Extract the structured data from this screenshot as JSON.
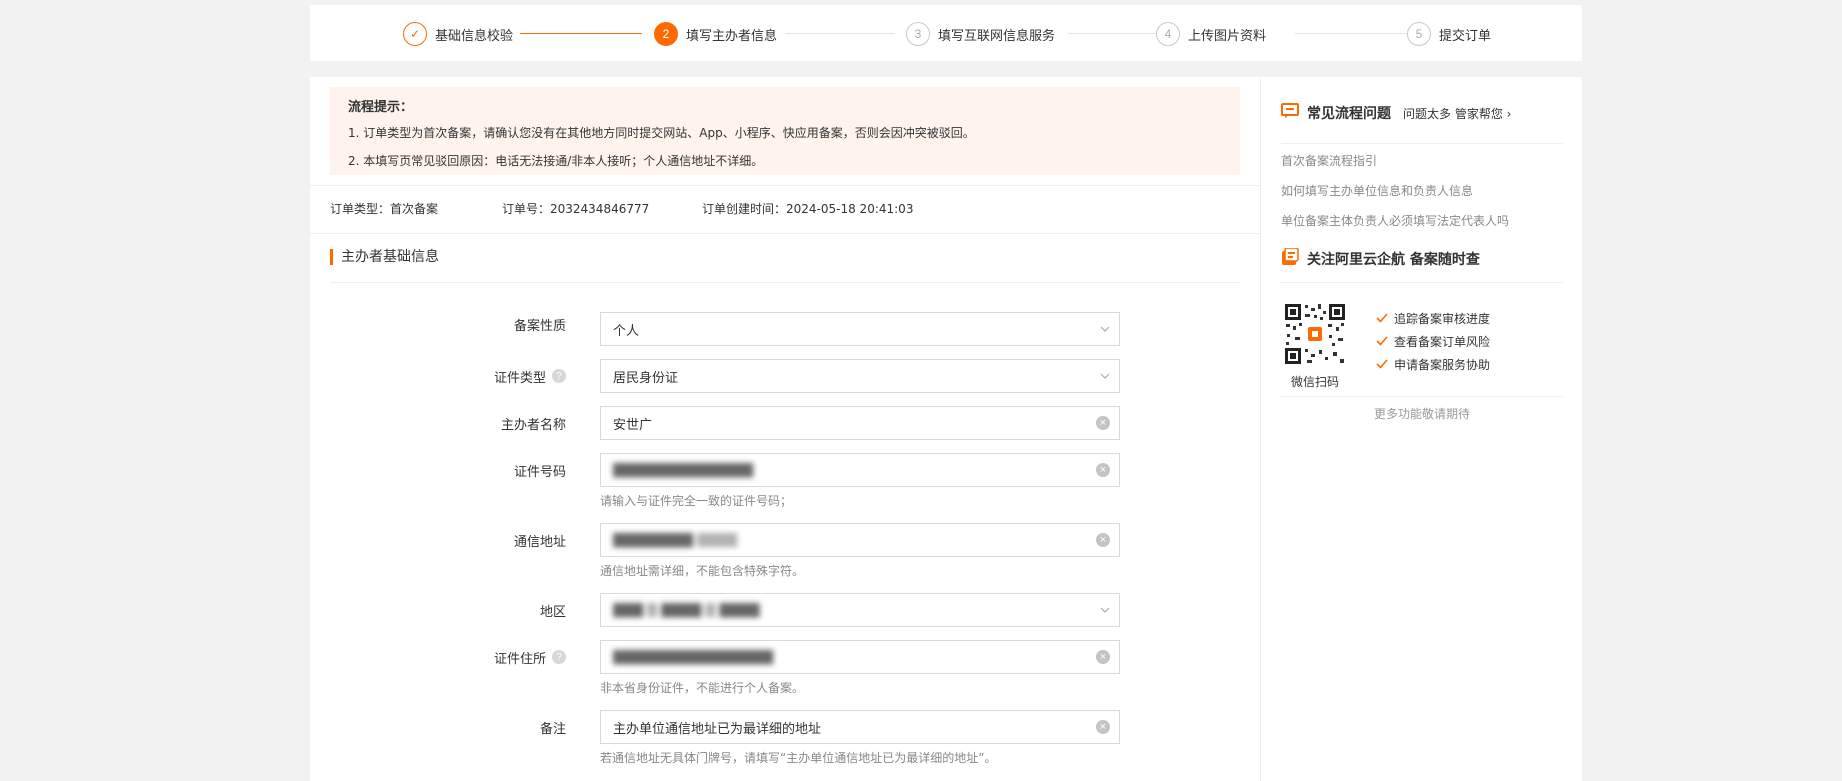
{
  "steps": [
    {
      "num": "✓",
      "label": "基础信息校验",
      "state": "done"
    },
    {
      "num": "2",
      "label": "填写主办者信息",
      "state": "active"
    },
    {
      "num": "3",
      "label": "填写互联网信息服务",
      "state": "todo"
    },
    {
      "num": "4",
      "label": "上传图片资料",
      "state": "todo"
    },
    {
      "num": "5",
      "label": "提交订单",
      "state": "todo"
    }
  ],
  "tips": {
    "title": "流程提示：",
    "line1": "1. 订单类型为首次备案，请确认您没有在其他地方同时提交网站、App、小程序、快应用备案，否则会因冲突被驳回。",
    "line2": "2. 本填写页常见驳回原因：电话无法接通/非本人接听；个人通信地址不详细。"
  },
  "order": {
    "type": "订单类型：首次备案",
    "number": "订单号：2032434846777",
    "created": "订单创建时间：2024-05-18 20:41:03"
  },
  "section": {
    "title": "主办者基础信息"
  },
  "form": {
    "nature": {
      "label": "备案性质",
      "value": "个人"
    },
    "cert_type": {
      "label": "证件类型",
      "value": "居民身份证"
    },
    "sponsor_name": {
      "label": "主办者名称",
      "value": "安世广"
    },
    "cert_number": {
      "label": "证件号码",
      "value": "",
      "hint": "请输入与证件完全一致的证件号码；"
    },
    "address": {
      "label": "通信地址",
      "value": "",
      "hint": "通信地址需详细，不能包含特殊字符。"
    },
    "region": {
      "label": "地区",
      "value": ""
    },
    "cert_address": {
      "label": "证件住所",
      "value": "",
      "hint": "非本省身份证件，不能进行个人备案。"
    },
    "remark": {
      "label": "备注",
      "value": "主办单位通信地址已为最详细的地址",
      "hint": "若通信地址无具体门牌号，请填写“主办单位通信地址已为最详细的地址”。"
    }
  },
  "sidebar": {
    "faq_title": "常见流程问题",
    "faq_sub": "问题太多 管家帮您",
    "faq_links": [
      "首次备案流程指引",
      "如何填写主办单位信息和负责人信息",
      "单位备案主体负责人必须填写法定代表人吗"
    ],
    "follow_title": "关注阿里云企航 备案随时查",
    "qr_label": "微信扫码",
    "features": [
      "追踪备案审核进度",
      "查看备案订单风险",
      "申请备案服务协助"
    ],
    "more": "更多功能敬请期待"
  },
  "colors": {
    "accent": "#ff6a00",
    "tips_bg": "#fff3ee",
    "page_bg": "#f2f2f2"
  }
}
